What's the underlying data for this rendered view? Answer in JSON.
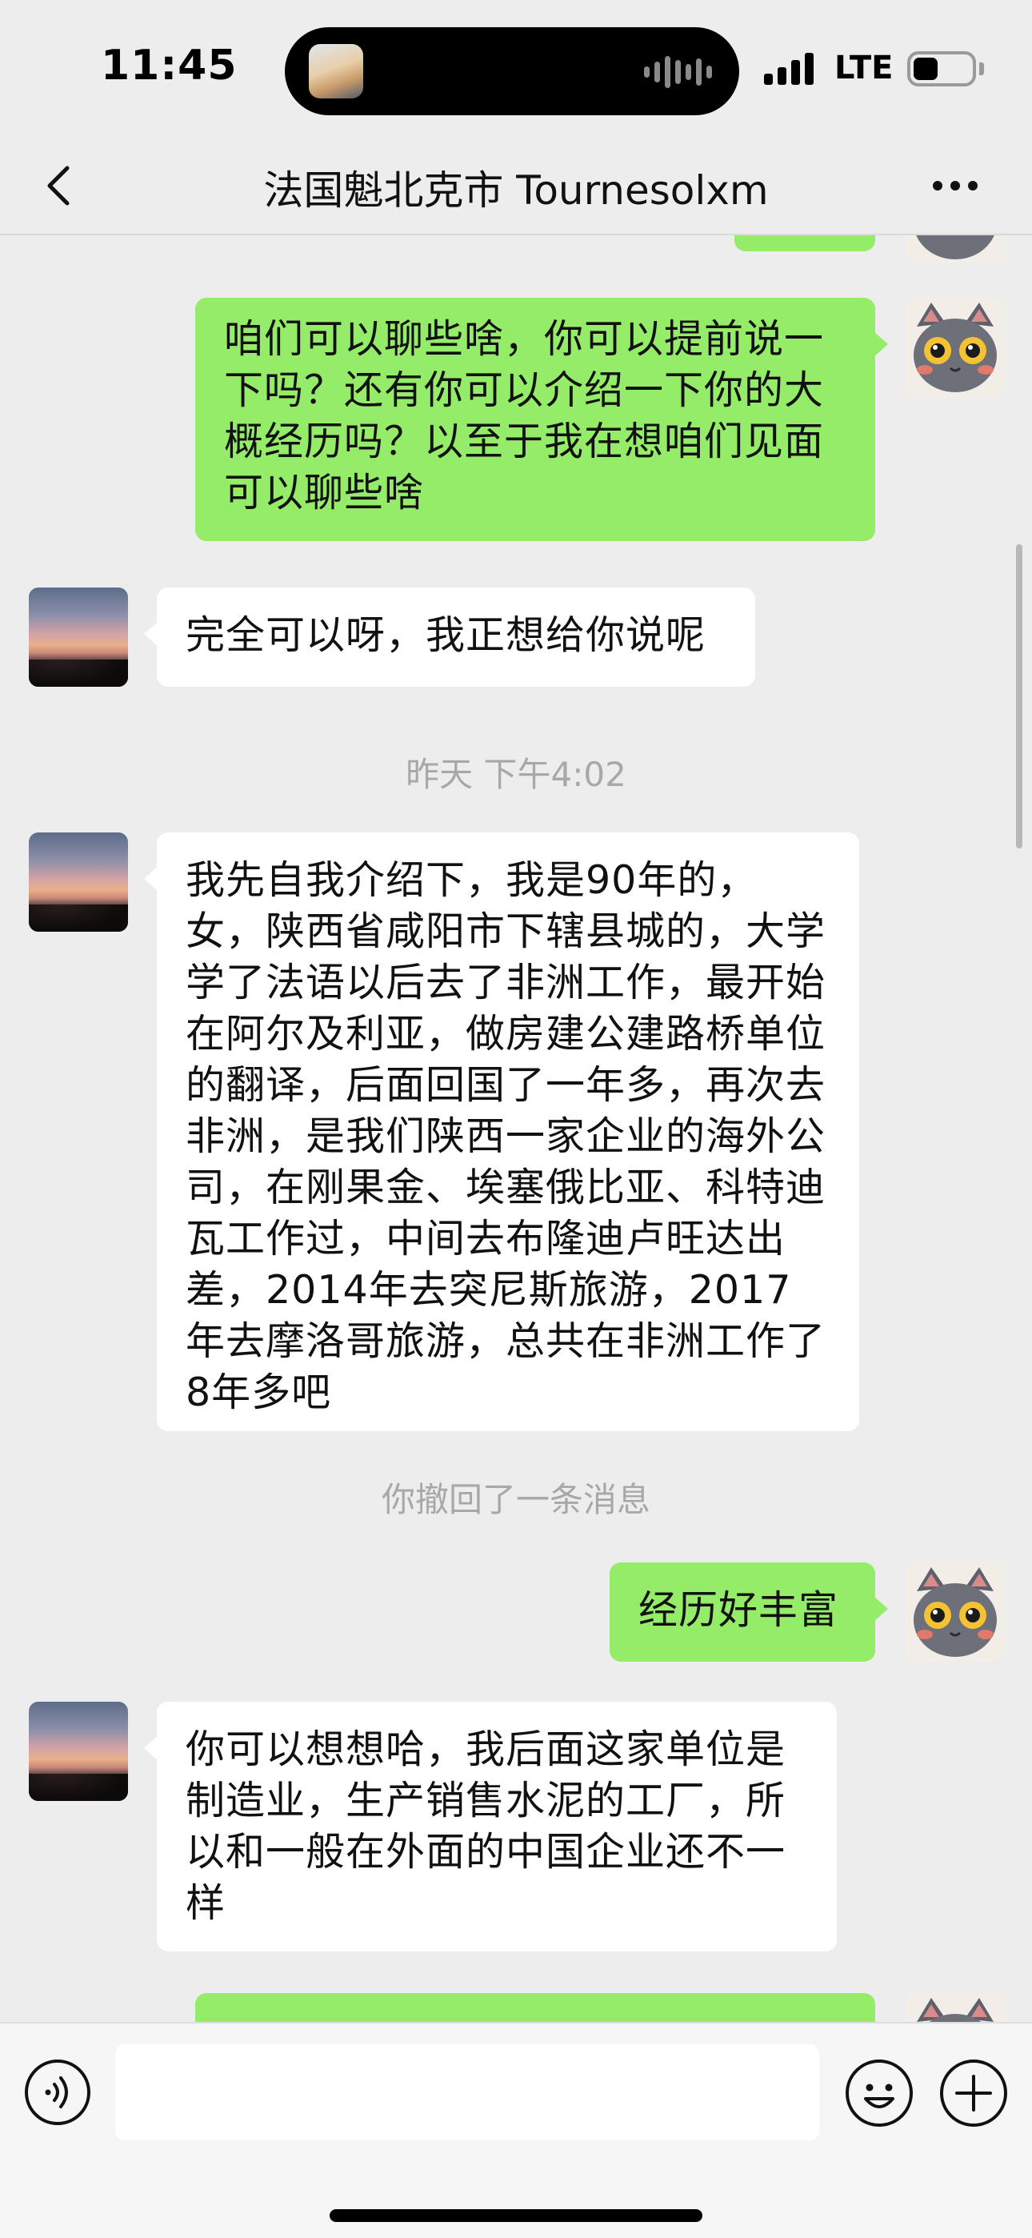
{
  "status_bar": {
    "time": "11:45",
    "network": "LTE"
  },
  "nav": {
    "title": "法国魁北克市 Tournesolxm"
  },
  "messages": [
    {
      "side": "out",
      "text": "咱们可以聊些啥，你可以提前说一下吗？还有你可以介绍一下你的大概经历吗？以至于我在想咱们见面可以聊些啥"
    },
    {
      "side": "in",
      "text": "完全可以呀，我正想给你说呢"
    },
    {
      "side": "in",
      "text": "我先自我介绍下，我是90年的，女，陕西省咸阳市下辖县城的，大学学了法语以后去了非洲工作，最开始在阿尔及利亚，做房建公建路桥单位的翻译，后面回国了一年多，再次去非洲，是我们陕西一家企业的海外公司，在刚果金、埃塞俄比亚、科特迪瓦工作过，中间去布隆迪卢旺达出差，2014年去突尼斯旅游，2017年去摩洛哥旅游，总共在非洲工作了8年多吧"
    },
    {
      "side": "out",
      "text": "经历好丰富"
    },
    {
      "side": "in",
      "text": "你可以想想哈，我后面这家单位是制造业，生产销售水泥的工厂，所以和一般在外面的中国企业还不一样"
    }
  ],
  "timestamp": "昨天 下午4:02",
  "recall_notice": "你撤回了一条消息",
  "colors": {
    "outgoing_bubble": "#95ec69",
    "incoming_bubble": "#ffffff",
    "background": "#ededed"
  },
  "icons": {
    "back": "chevron-left-icon",
    "more": "more-dots-icon",
    "voice": "voice-icon",
    "emoji": "emoji-icon",
    "plus": "plus-icon"
  }
}
